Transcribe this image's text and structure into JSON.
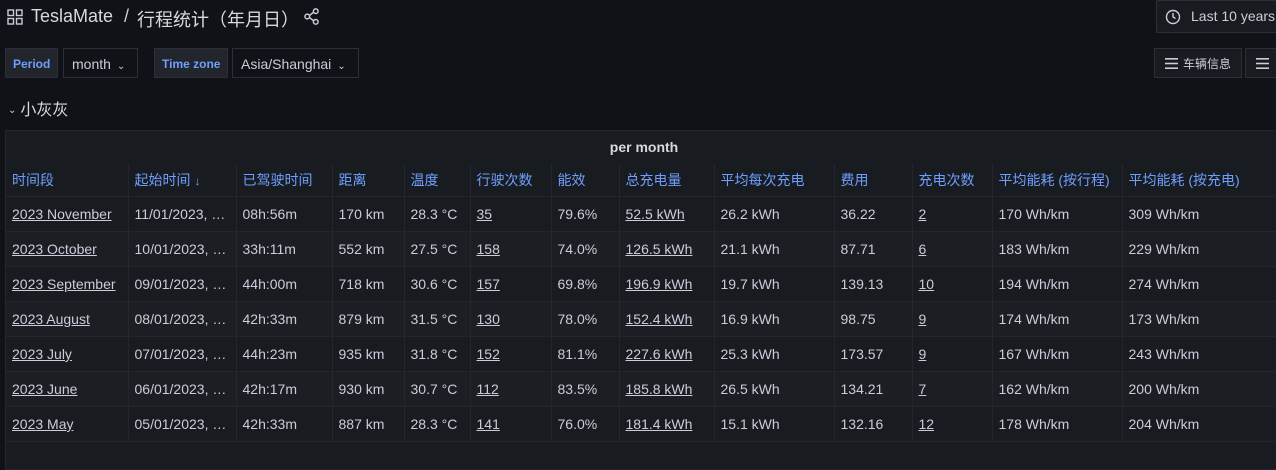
{
  "header": {
    "app_name": "TeslaMate",
    "separator": "/",
    "page_title": "行程统计（年月日）",
    "time_range": "Last 10 years"
  },
  "variables": [
    {
      "label": "Period",
      "value": "month"
    },
    {
      "label": "Time zone",
      "value": "Asia/Shanghai"
    }
  ],
  "links": [
    {
      "label": "车辆信息"
    },
    {
      "label": ""
    }
  ],
  "row": {
    "title": "小灰灰"
  },
  "panel": {
    "title": "per month",
    "columns": [
      "时间段",
      "起始时间",
      "已驾驶时间",
      "距离",
      "温度",
      "行驶次数",
      "能效",
      "总充电量",
      "平均每次充电",
      "费用",
      "充电次数",
      "平均能耗 (按行程)",
      "平均能耗 (按充电)"
    ],
    "rows": [
      [
        "2023 November",
        "11/01/2023, …",
        "08h:56m",
        "170 km",
        "28.3 °C",
        "35",
        "79.6%",
        "52.5 kWh",
        "26.2 kWh",
        "36.22",
        "2",
        "170 Wh/km",
        "309 Wh/km"
      ],
      [
        "2023 October",
        "10/01/2023, …",
        "33h:11m",
        "552 km",
        "27.5 °C",
        "158",
        "74.0%",
        "126.5 kWh",
        "21.1 kWh",
        "87.71",
        "6",
        "183 Wh/km",
        "229 Wh/km"
      ],
      [
        "2023 September",
        "09/01/2023, …",
        "44h:00m",
        "718 km",
        "30.6 °C",
        "157",
        "69.8%",
        "196.9 kWh",
        "19.7 kWh",
        "139.13",
        "10",
        "194 Wh/km",
        "274 Wh/km"
      ],
      [
        "2023 August",
        "08/01/2023, …",
        "42h:33m",
        "879 km",
        "31.5 °C",
        "130",
        "78.0%",
        "152.4 kWh",
        "16.9 kWh",
        "98.75",
        "9",
        "174 Wh/km",
        "173 Wh/km"
      ],
      [
        "2023 July",
        "07/01/2023, …",
        "44h:23m",
        "935 km",
        "31.8 °C",
        "152",
        "81.1%",
        "227.6 kWh",
        "25.3 kWh",
        "173.57",
        "9",
        "167 Wh/km",
        "243 Wh/km"
      ],
      [
        "2023 June",
        "06/01/2023, …",
        "42h:17m",
        "930 km",
        "30.7 °C",
        "112",
        "83.5%",
        "185.8 kWh",
        "26.5 kWh",
        "134.21",
        "7",
        "162 Wh/km",
        "200 Wh/km"
      ],
      [
        "2023 May",
        "05/01/2023, …",
        "42h:33m",
        "887 km",
        "28.3 °C",
        "141",
        "76.0%",
        "181.4 kWh",
        "15.1 kWh",
        "132.16",
        "12",
        "178 Wh/km",
        "204 Wh/km"
      ]
    ]
  },
  "colors": {
    "background": "#111217",
    "panel": "#181b1f",
    "header_text": "#6e9fff",
    "temperature": "#ff9e9e",
    "efficiency": "#f2b84b"
  }
}
